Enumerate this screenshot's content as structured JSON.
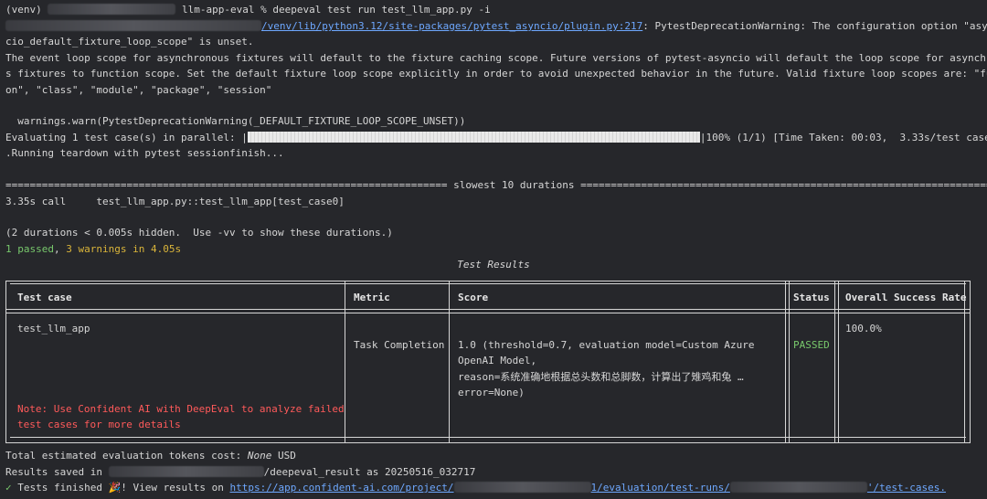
{
  "terminal": {
    "prompt": "(venv)",
    "cwd_suffix": "llm-app-eval % ",
    "command": "deepeval test run test_llm_app.py -i",
    "warning_path": "/venv/lib/python3.12/site-packages/pytest_asyncio/plugin.py:217",
    "warning_text_1": ": PytestDeprecationWarning: The configuration option \"asyn",
    "warning_text_2": "cio_default_fixture_loop_scope\" is unset.",
    "warning_text_3": "The event loop scope for asynchronous fixtures will default to the fixture caching scope. Future versions of pytest-asyncio will default the loop scope for asynchronou",
    "warning_text_4": "s fixtures to function scope. Set the default fixture loop scope explicitly in order to avoid unexpected behavior in the future. Valid fixture loop scopes are: \"functi",
    "warning_text_5": "on\", \"class\", \"module\", \"package\", \"session\"",
    "warnings_warn": "  warnings.warn(PytestDeprecationWarning(_DEFAULT_FIXTURE_LOOP_SCOPE_UNSET))",
    "evaluating_prefix": "Evaluating 1 test case(s) in parallel: |",
    "progress_fraction": 1.0,
    "evaluating_suffix": "|100% (1/1) [Time Taken: 00:03,  3.33s/test case]",
    "teardown": ".Running teardown with pytest sessionfinish...",
    "slowest_rule": "========================================================================= slowest 10 durations ==========================================================================",
    "duration_line": "3.35s call     test_llm_app.py::test_llm_app[test_case0]",
    "hidden_line": "(2 durations < 0.005s hidden.  Use -vv to show these durations.)",
    "passed": "1 passed",
    "comma": ", ",
    "warnings_count": "3 warnings",
    "in_time": " in 4.05s",
    "tokens_cost_prefix": "Total estimated evaluation tokens cost: ",
    "tokens_cost_value": "None",
    "tokens_cost_unit": " USD",
    "results_saved_prefix": "Results saved in ",
    "results_saved_dir": "/deepeval_result",
    "results_saved_suffix": " as 20250516_032717",
    "tests_finished_check": "✓",
    "tests_finished_text": " Tests finished 🎉! View results on ",
    "link_part_1": "https://app.confident-ai.com/project/",
    "link_part_2": "1/evaluation/test-runs/",
    "link_part_3": "'/test-cases."
  },
  "table": {
    "title": "Test Results",
    "headers": [
      "Test case",
      "Metric",
      "Score",
      "Status",
      "Overall Success Rate"
    ],
    "test_case": "test_llm_app",
    "metric": "Task Completion",
    "score_lines": [
      "1.0 (threshold=0.7, evaluation model=Custom Azure",
      "OpenAI Model,",
      "reason=系统准确地根据总头数和总脚数，计算出了雉鸡和兔 …",
      "error=None)"
    ],
    "status": "PASSED",
    "success_rate": "100.0%",
    "note_line_1": "Note: Use Confident AI with DeepEval to analyze failed",
    "note_line_2": "test cases for more details"
  },
  "colors": {
    "background": "#26272b",
    "text": "#d6d6d6",
    "link": "#6ea8ff",
    "passed": "#78c86c",
    "warning": "#d9b43a",
    "note": "#ff5a5a"
  }
}
